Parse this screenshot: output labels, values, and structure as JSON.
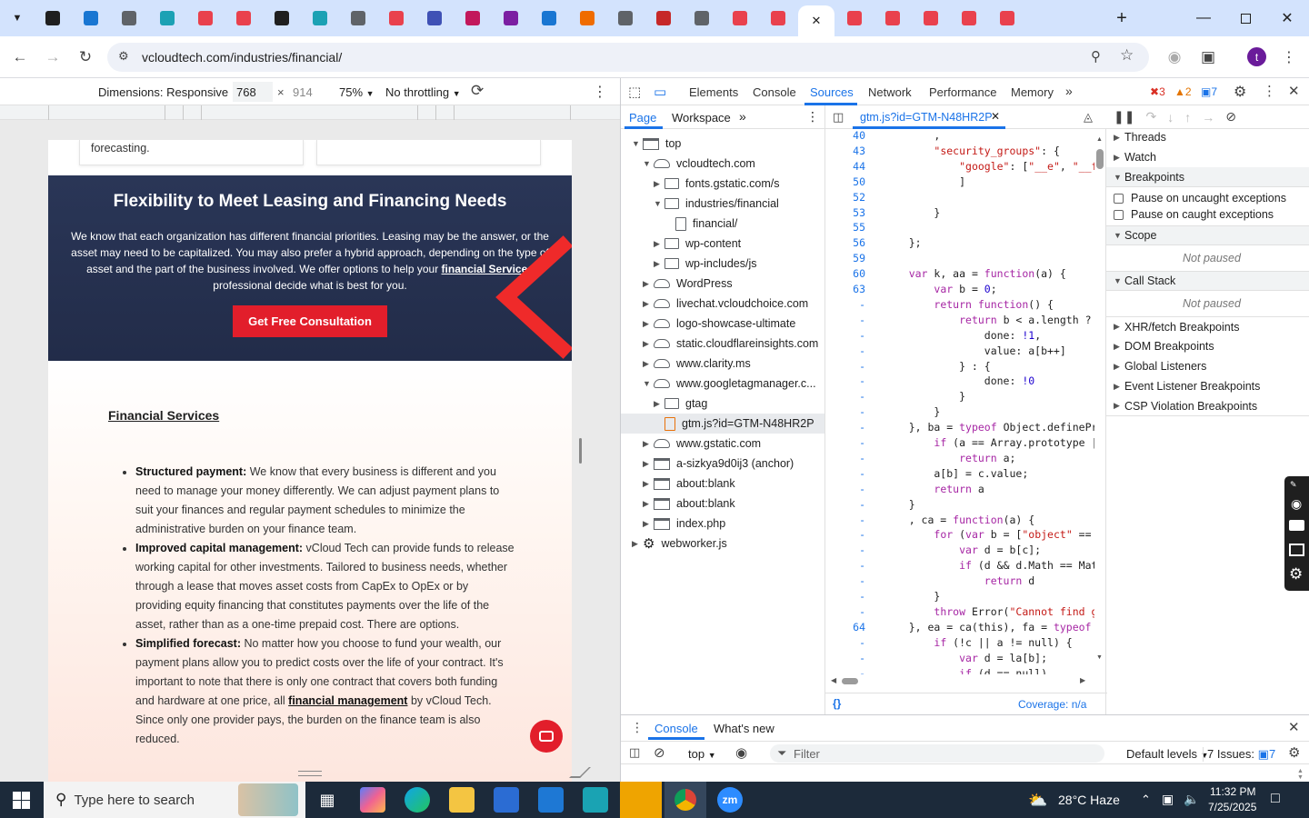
{
  "browser": {
    "url": "vcloudtech.com/industries/financial/",
    "profile_initial": "t",
    "tab_icon_colors": [
      "#1f1f1f",
      "#1976d2",
      "#5f6368",
      "#1ba1b4",
      "#e9414d",
      "#e9414d",
      "#1f1f1f",
      "#1ba1b4",
      "#5f6368",
      "#e9414d",
      "#3f51b5",
      "#c2185b",
      "#7b1fa2",
      "#1976d2",
      "#ef6c00",
      "#5f6368",
      "#c62828",
      "#5f6368",
      "#e9414d",
      "#e9414d",
      "#e9414d",
      "#e9414d",
      "#e9414d",
      "#e9414d",
      "#e9414d",
      "#e9414d"
    ],
    "new_tab_label": "+"
  },
  "device_toolbar": {
    "dimensions_label": "Dimensions: Responsive",
    "width": "768",
    "height": "914",
    "zoom": "75%",
    "throttling": "No throttling"
  },
  "site": {
    "card_left_text": "forecasting.",
    "banner": {
      "title": "Flexibility to Meet Leasing and Financing Needs",
      "body_1": "We know that each organization has different financial priorities. Leasing may be the answer, or the asset may need to be capitalized. You may also prefer a hybrid approach, depending on the type of asset and the part of the business involved. We offer options to help your ",
      "body_link": "financial Services",
      "body_2": " professional decide what is best for you.",
      "cta": "Get Free Consultation"
    },
    "section_title": "Financial Services",
    "items": [
      {
        "bold": "Structured payment:",
        "text": " We know that every business is different and you need to manage your money differently. We can adjust payment plans to suit your finances and regular payment schedules to minimize the administrative burden on your finance team."
      },
      {
        "bold": "Improved capital management:",
        "text": " vCloud Tech can provide funds to release working capital for other investments. Tailored to business needs, whether through a lease that moves asset costs from CapEx to OpEx or by providing equity financing that constitutes payments over the life of the asset, rather than as a one-time prepaid cost. There are options."
      },
      {
        "bold": "Simplified forecast:",
        "text": " No matter how you choose to fund your wealth, our payment plans allow you to predict costs over the life of your contract. It's important to note that there is only one contract that covers both funding and hardware at one price, all ",
        "link": "financial management",
        "text2": " by vCloud Tech. Since only one provider pays, the burden on the finance team is also reduced."
      }
    ]
  },
  "devtools": {
    "tabs": [
      "Elements",
      "Console",
      "Sources",
      "Network",
      "Performance",
      "Memory"
    ],
    "selected_tab": "Sources",
    "errors": "3",
    "warnings": "2",
    "messages": "7",
    "navigator_tabs": [
      "Page",
      "Workspace"
    ],
    "tree": [
      {
        "label": "top",
        "kind": "frame",
        "arrow": "down"
      },
      {
        "label": "vcloudtech.com",
        "kind": "cloud",
        "arrow": "down"
      },
      {
        "label": "fonts.gstatic.com/s",
        "kind": "folder",
        "arrow": "right"
      },
      {
        "label": "industries/financial",
        "kind": "folder",
        "arrow": "down"
      },
      {
        "label": "financial/",
        "kind": "file",
        "arrow": ""
      },
      {
        "label": "wp-content",
        "kind": "folder",
        "arrow": "right"
      },
      {
        "label": "wp-includes/js",
        "kind": "folder",
        "arrow": "right"
      },
      {
        "label": "WordPress",
        "kind": "cloud",
        "arrow": "right"
      },
      {
        "label": "livechat.vcloudchoice.com",
        "kind": "cloud",
        "arrow": "right"
      },
      {
        "label": "logo-showcase-ultimate",
        "kind": "cloud",
        "arrow": "right"
      },
      {
        "label": "static.cloudflareinsights.com",
        "kind": "cloud",
        "arrow": "right"
      },
      {
        "label": "www.clarity.ms",
        "kind": "cloud",
        "arrow": "right"
      },
      {
        "label": "www.googletagmanager.c...",
        "kind": "cloud",
        "arrow": "down"
      },
      {
        "label": "gtag",
        "kind": "folder",
        "arrow": "right"
      },
      {
        "label": "gtm.js?id=GTM-N48HR2P",
        "kind": "file-or",
        "arrow": "",
        "selected": true
      },
      {
        "label": "www.gstatic.com",
        "kind": "cloud",
        "arrow": "right"
      },
      {
        "label": "a-sizkya9d0ij3 (anchor)",
        "kind": "frame",
        "arrow": "right"
      },
      {
        "label": "about:blank",
        "kind": "frame",
        "arrow": "right"
      },
      {
        "label": "about:blank",
        "kind": "frame",
        "arrow": "right"
      },
      {
        "label": "index.php",
        "kind": "frame",
        "arrow": "right"
      },
      {
        "label": "webworker.js",
        "kind": "gear",
        "arrow": "right"
      }
    ],
    "editor_file": "gtm.js?id=GTM-N48HR2P",
    "code": [
      {
        "ln": "40",
        "code": "        ,"
      },
      {
        "ln": "43",
        "code": "        \"security_groups\": {"
      },
      {
        "ln": "44",
        "code": "            \"google\": [\"__e\", \"__f\""
      },
      {
        "ln": "50",
        "code": "            ]"
      },
      {
        "ln": "52",
        "code": ""
      },
      {
        "ln": "53",
        "code": "        }"
      },
      {
        "ln": "55",
        "code": ""
      },
      {
        "ln": "56",
        "code": "    };"
      },
      {
        "ln": "59",
        "code": ""
      },
      {
        "ln": "60",
        "code": "    var k, aa = function(a) {"
      },
      {
        "ln": "63",
        "code": "        var b = 0;"
      },
      {
        "ln": "-",
        "code": "        return function() {"
      },
      {
        "ln": "-",
        "code": "            return b < a.length ? {"
      },
      {
        "ln": "-",
        "code": "                done: !1,"
      },
      {
        "ln": "-",
        "code": "                value: a[b++]"
      },
      {
        "ln": "-",
        "code": "            } : {"
      },
      {
        "ln": "-",
        "code": "                done: !0"
      },
      {
        "ln": "-",
        "code": "            }"
      },
      {
        "ln": "-",
        "code": "        }"
      },
      {
        "ln": "-",
        "code": "    }, ba = typeof Object.definePro"
      },
      {
        "ln": "-",
        "code": "        if (a == Array.prototype ||"
      },
      {
        "ln": "-",
        "code": "            return a;"
      },
      {
        "ln": "-",
        "code": "        a[b] = c.value;"
      },
      {
        "ln": "-",
        "code": "        return a"
      },
      {
        "ln": "-",
        "code": "    }"
      },
      {
        "ln": "-",
        "code": "    , ca = function(a) {"
      },
      {
        "ln": "-",
        "code": "        for (var b = [\"object\" == t"
      },
      {
        "ln": "-",
        "code": "            var d = b[c];"
      },
      {
        "ln": "-",
        "code": "            if (d && d.Math == Math"
      },
      {
        "ln": "-",
        "code": "                return d"
      },
      {
        "ln": "-",
        "code": "        }"
      },
      {
        "ln": "-",
        "code": "        throw Error(\"Cannot find gl"
      },
      {
        "ln": "64",
        "code": "    }, ea = ca(this), fa = typeof S"
      },
      {
        "ln": "-",
        "code": "        if (!c || a != null) {"
      },
      {
        "ln": "-",
        "code": "            var d = la[b];"
      },
      {
        "ln": "-",
        "code": "            if (d == null)"
      }
    ],
    "coverage": "Coverage: n/a",
    "pretty_print": "{}",
    "debugger": {
      "threads": "Threads",
      "watch": "Watch",
      "breakpoints": "Breakpoints",
      "pause_uncaught": "Pause on uncaught exceptions",
      "pause_caught": "Pause on caught exceptions",
      "scope": "Scope",
      "not_paused_1": "Not paused",
      "call_stack": "Call Stack",
      "not_paused_2": "Not paused",
      "xhr": "XHR/fetch Breakpoints",
      "dom": "DOM Breakpoints",
      "global": "Global Listeners",
      "event": "Event Listener Breakpoints",
      "csp": "CSP Violation Breakpoints"
    },
    "drawer": {
      "tab_console": "Console",
      "tab_whats_new": "What's new",
      "context": "top",
      "filter_placeholder": "Filter",
      "levels": "Default levels",
      "issues_label": "7 Issues:",
      "issues_count": "7"
    }
  },
  "taskbar": {
    "search_placeholder": "Type here to search",
    "weather": "28°C  Haze",
    "time": "11:32 PM",
    "date": "7/25/2025"
  }
}
